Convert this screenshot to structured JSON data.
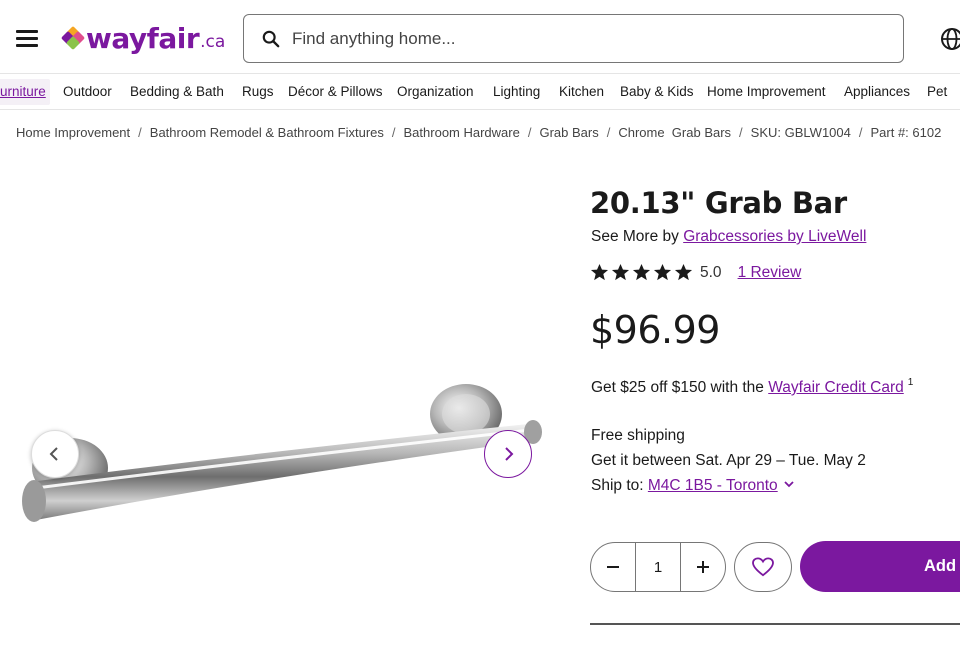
{
  "header": {
    "logo_text": "wayfair",
    "logo_tld": ".ca",
    "search_placeholder": "Find anything home...",
    "icons": [
      "menu-icon",
      "search-icon",
      "globe-icon"
    ]
  },
  "categories": [
    {
      "label": "urniture",
      "active": true
    },
    {
      "label": "Outdoor"
    },
    {
      "label": "Bedding & Bath"
    },
    {
      "label": "Rugs"
    },
    {
      "label": "Décor & Pillows"
    },
    {
      "label": "Organization"
    },
    {
      "label": "Lighting"
    },
    {
      "label": "Kitchen"
    },
    {
      "label": "Baby & Kids"
    },
    {
      "label": "Home Improvement"
    },
    {
      "label": "Appliances"
    },
    {
      "label": "Pet"
    }
  ],
  "breadcrumb": [
    "Home Improvement",
    "Bathroom Remodel & Bathroom Fixtures",
    "Bathroom Hardware",
    "Grab Bars",
    "Chrome  Grab Bars",
    "SKU: GBLW1004",
    "Part #: 6102"
  ],
  "product": {
    "title": "20.13\" Grab Bar",
    "see_more_prefix": "See More by ",
    "brand": "Grabcessories by LiveWell",
    "rating": "5.0",
    "stars": 5,
    "review_link": "1 Review",
    "price": "$96.99",
    "credit_prefix": "Get $25 off $150 with the ",
    "credit_link": "Wayfair Credit Card",
    "credit_footnote": "1",
    "shipping": "Free shipping",
    "delivery": "Get it between Sat. Apr 29 – Tue. May 2",
    "ship_to_prefix": "Ship to: ",
    "ship_to_link": "M4C 1B5 - Toronto",
    "quantity": "1",
    "add_to_cart": "Add to Cart"
  },
  "colors": {
    "brand": "#7b189f",
    "text": "#1a1a1a"
  }
}
